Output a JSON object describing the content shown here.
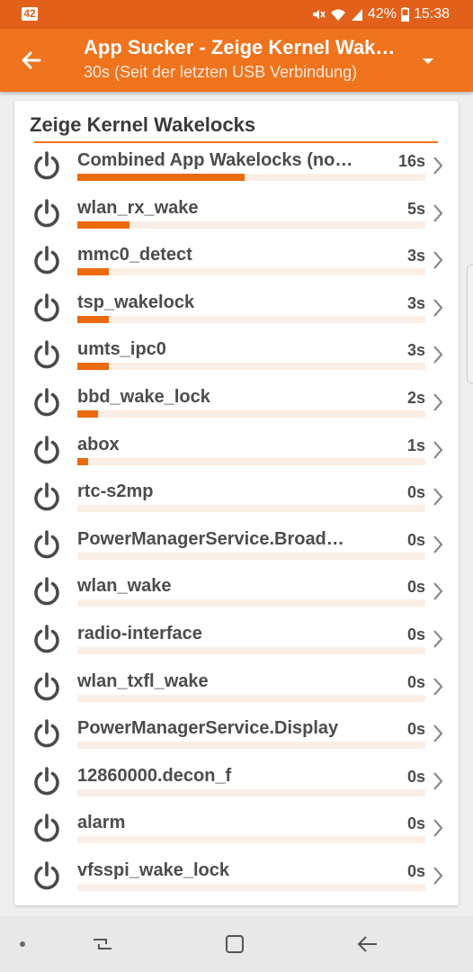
{
  "status_bar": {
    "notification_badge": "42",
    "icons": [
      "mute-icon",
      "wifi-icon",
      "signal-icon",
      "battery-icon"
    ],
    "battery": "42%",
    "time": "15:38"
  },
  "app_bar": {
    "title": "App Sucker - Zeige Kernel Wakelocks",
    "subtitle": "30s (Seit der letzten USB Verbindung)"
  },
  "card": {
    "title": "Zeige Kernel Wakelocks",
    "items": [
      {
        "label": "Combined App Wakelocks (no…",
        "value": "16s",
        "fraction": 0.48
      },
      {
        "label": "wlan_rx_wake",
        "value": "5s",
        "fraction": 0.15
      },
      {
        "label": "mmc0_detect",
        "value": "3s",
        "fraction": 0.09
      },
      {
        "label": "tsp_wakelock",
        "value": "3s",
        "fraction": 0.09
      },
      {
        "label": "umts_ipc0",
        "value": "3s",
        "fraction": 0.09
      },
      {
        "label": "bbd_wake_lock",
        "value": "2s",
        "fraction": 0.06
      },
      {
        "label": "abox",
        "value": "1s",
        "fraction": 0.03
      },
      {
        "label": "rtc-s2mp",
        "value": "0s",
        "fraction": 0
      },
      {
        "label": "PowerManagerService.Broad…",
        "value": "0s",
        "fraction": 0
      },
      {
        "label": "wlan_wake",
        "value": "0s",
        "fraction": 0
      },
      {
        "label": "radio-interface",
        "value": "0s",
        "fraction": 0
      },
      {
        "label": "wlan_txfl_wake",
        "value": "0s",
        "fraction": 0
      },
      {
        "label": "PowerManagerService.Display",
        "value": "0s",
        "fraction": 0
      },
      {
        "label": "12860000.decon_f",
        "value": "0s",
        "fraction": 0
      },
      {
        "label": "alarm",
        "value": "0s",
        "fraction": 0
      },
      {
        "label": "vfsspi_wake_lock",
        "value": "0s",
        "fraction": 0
      }
    ]
  },
  "colors": {
    "status_bar": "#e2601a",
    "app_bar": "#f0731d",
    "bar_fill": "#ec6a0e",
    "bar_track": "#fbeee4"
  }
}
